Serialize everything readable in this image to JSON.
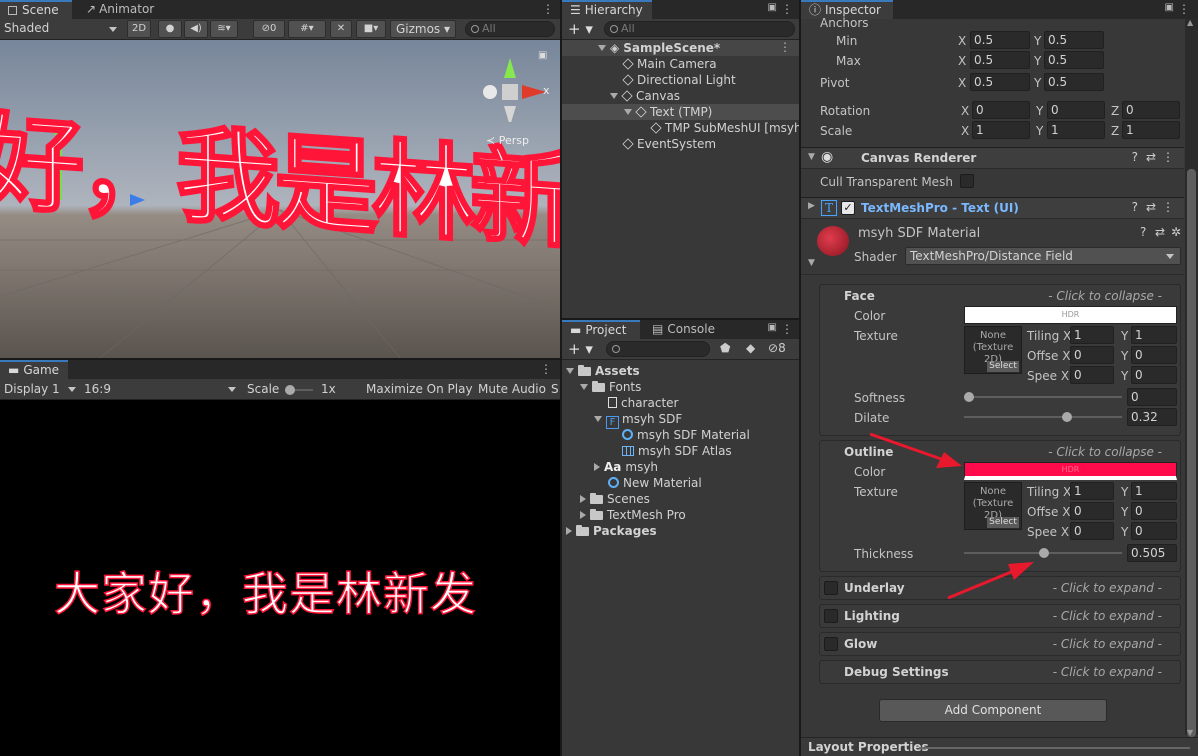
{
  "scene": {
    "tabs": [
      "Scene",
      "Animator"
    ],
    "shading_mode": "Shaded",
    "mode_2d": "2D",
    "visibility_count": "0",
    "gizmos_label": "Gizmos",
    "search_placeholder": "All",
    "gizmo_axis_label": "x",
    "persp_label": "Persp",
    "viewport_text": "好，我是林新发"
  },
  "game": {
    "tab": "Game",
    "display": "Display 1",
    "aspect": "16:9",
    "scale_label": "Scale",
    "scale_value": "1x",
    "maximize_label": "Maximize On Play",
    "mute_label": "Mute Audio",
    "stats_label": "S",
    "game_text": "大家好，我是林新发"
  },
  "hierarchy": {
    "tab": "Hierarchy",
    "search_placeholder": "All",
    "items": [
      {
        "label": "SampleScene*"
      },
      {
        "label": "Main Camera"
      },
      {
        "label": "Directional Light"
      },
      {
        "label": "Canvas"
      },
      {
        "label": "Text (TMP)"
      },
      {
        "label": "TMP SubMeshUI [msyh"
      },
      {
        "label": "EventSystem"
      }
    ]
  },
  "project": {
    "tabs": [
      "Project",
      "Console"
    ],
    "hidden_count": "8",
    "items": [
      {
        "label": "Assets"
      },
      {
        "label": "Fonts"
      },
      {
        "label": "character"
      },
      {
        "label": "msyh SDF"
      },
      {
        "label": "msyh SDF Material"
      },
      {
        "label": "msyh SDF Atlas"
      },
      {
        "label": "msyh"
      },
      {
        "label": "New Material"
      },
      {
        "label": "Scenes"
      },
      {
        "label": "TextMesh Pro"
      },
      {
        "label": "Packages"
      }
    ],
    "font_icon_text": "Aa"
  },
  "inspector": {
    "tab": "Inspector",
    "anchors_label": "Anchors",
    "min_label": "Min",
    "max_label": "Max",
    "pivot_label": "Pivot",
    "rotation_label": "Rotation",
    "scale_label": "Scale",
    "axis_x": "X",
    "axis_y": "Y",
    "axis_z": "Z",
    "min": {
      "x": "0.5",
      "y": "0.5"
    },
    "max": {
      "x": "0.5",
      "y": "0.5"
    },
    "pivot": {
      "x": "0.5",
      "y": "0.5"
    },
    "rotation": {
      "x": "0",
      "y": "0",
      "z": "0"
    },
    "scale": {
      "x": "1",
      "y": "1",
      "z": "1"
    },
    "canvas_renderer_title": "Canvas Renderer",
    "cull_label": "Cull Transparent Mesh",
    "tmp_title": "TextMeshPro - Text (UI)",
    "tmp_icon": "T",
    "material_name": "msyh SDF Material",
    "shader_label": "Shader",
    "shader_value": "TextMeshPro/Distance Field",
    "face": {
      "title": "Face",
      "hint": "- Click to collapse -",
      "color_label": "Color",
      "color_value": "HDR",
      "color_hex": "#ffffff",
      "texture_label": "Texture",
      "texture_none": "None (Texture 2D)",
      "select": "Select",
      "tiling_label": "Tiling",
      "offset_label": "Offse",
      "speed_label": "Spee",
      "tiling": {
        "x": "1",
        "y": "1"
      },
      "offset": {
        "x": "0",
        "y": "0"
      },
      "speed": {
        "x": "0",
        "y": "0"
      },
      "softness_label": "Softness",
      "softness_value": "0",
      "dilate_label": "Dilate",
      "dilate_value": "0.32"
    },
    "outline": {
      "title": "Outline",
      "hint": "- Click to collapse -",
      "color_label": "Color",
      "color_value": "HDR",
      "color_hex": "#ff0a4a",
      "texture_label": "Texture",
      "texture_none": "None (Texture 2D)",
      "select": "Select",
      "tiling_label": "Tiling",
      "offset_label": "Offse",
      "speed_label": "Spee",
      "tiling": {
        "x": "1",
        "y": "1"
      },
      "offset": {
        "x": "0",
        "y": "0"
      },
      "speed": {
        "x": "0",
        "y": "0"
      },
      "thickness_label": "Thickness",
      "thickness_value": "0.505"
    },
    "collapsed_sections": [
      {
        "title": "Underlay",
        "hint": "- Click to expand -"
      },
      {
        "title": "Lighting",
        "hint": "- Click to expand -"
      },
      {
        "title": "Glow",
        "hint": "- Click to expand -"
      },
      {
        "title": "Debug Settings",
        "hint": "- Click to expand -"
      }
    ],
    "add_component": "Add Component",
    "layout_properties": "Layout Properties"
  }
}
